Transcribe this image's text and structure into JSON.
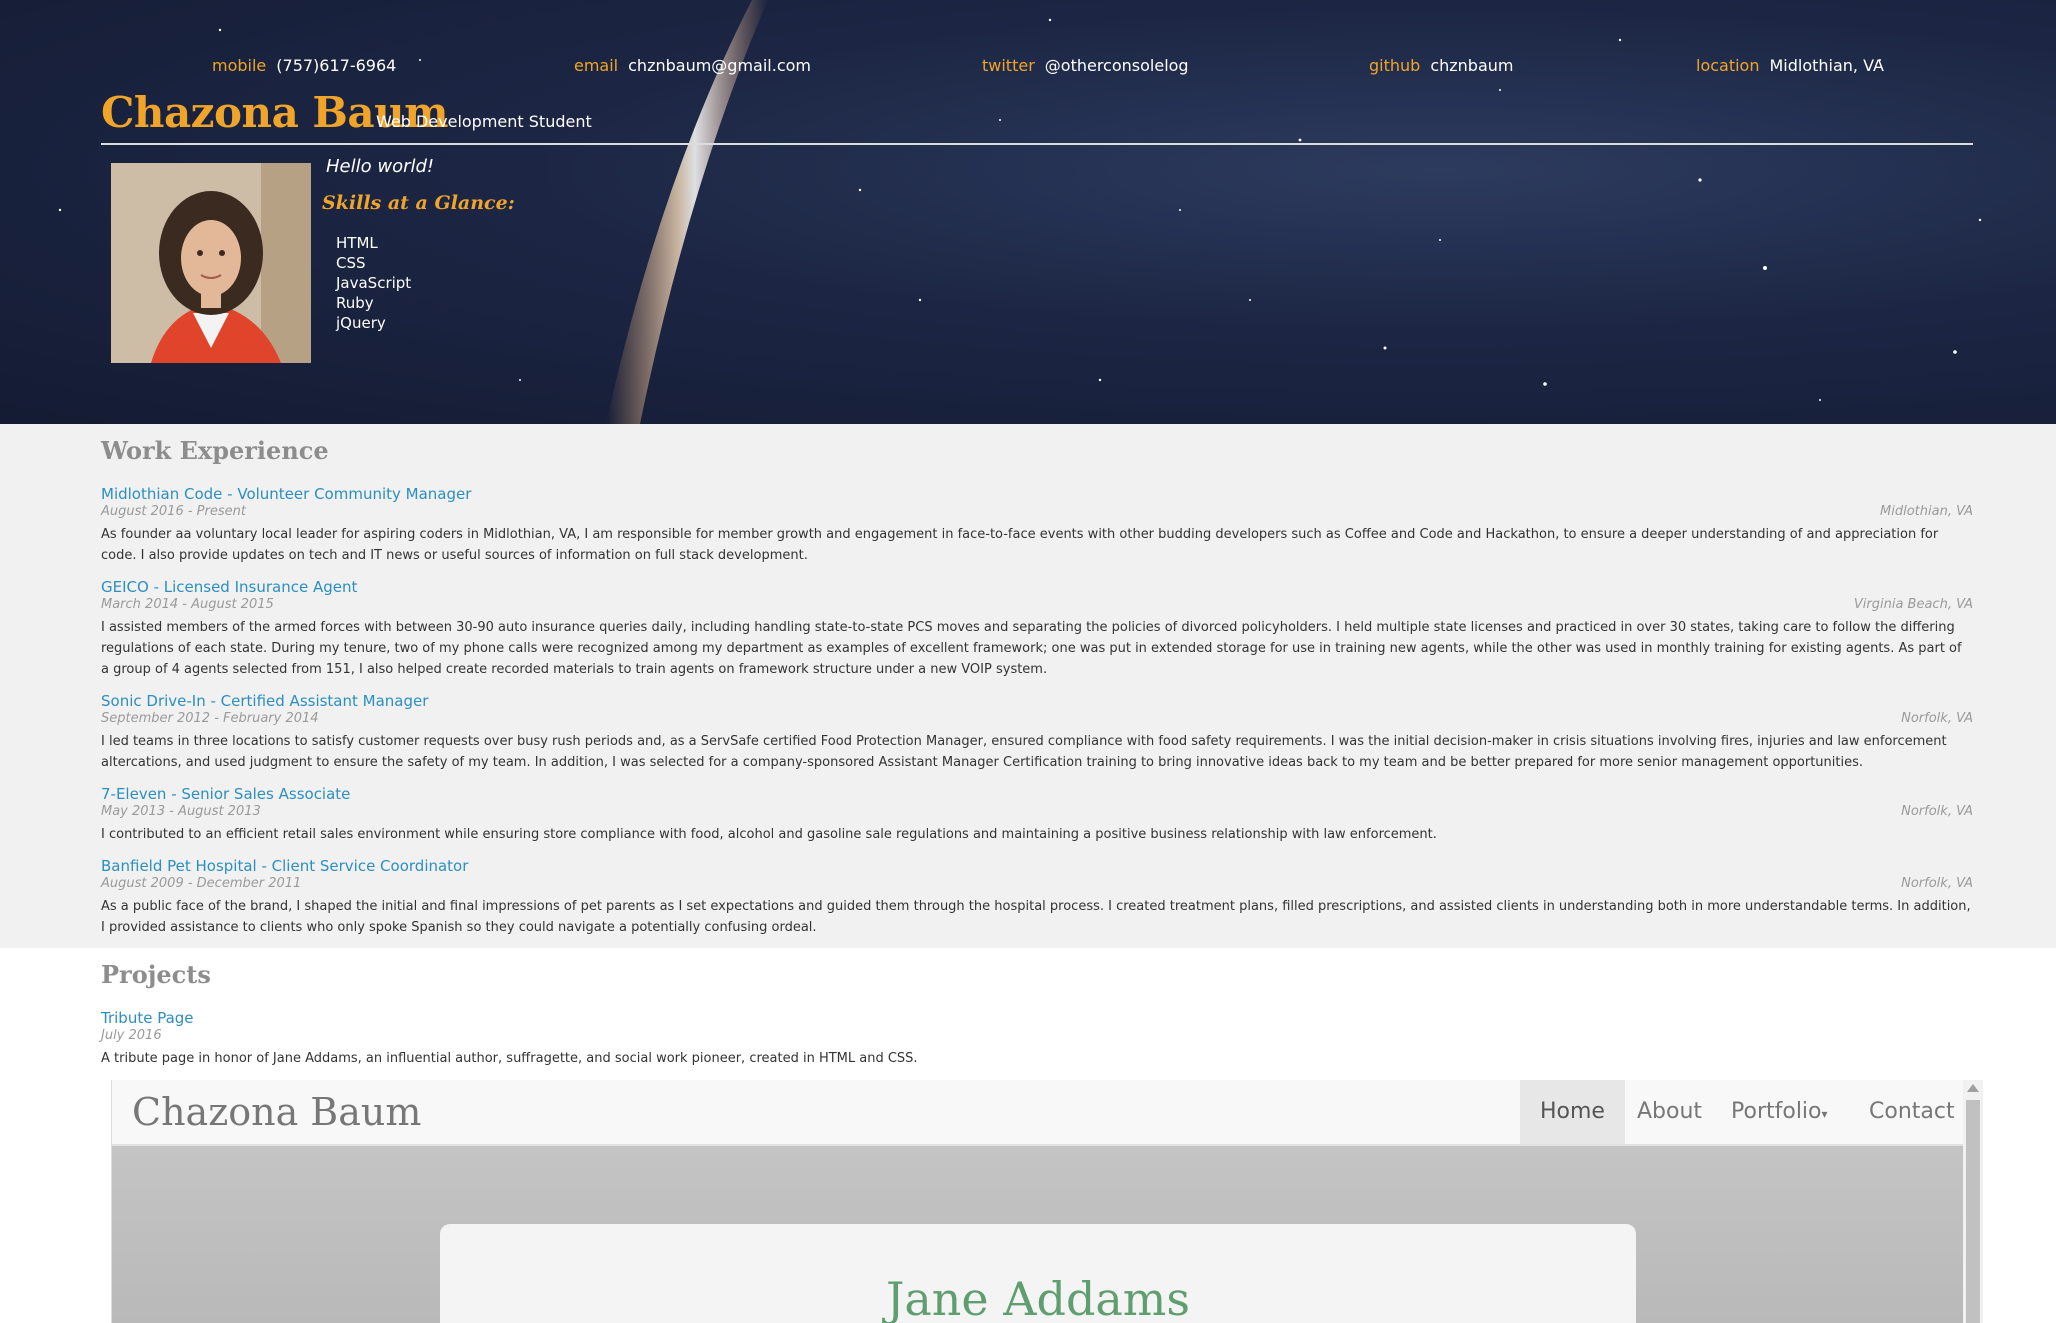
{
  "header": {
    "contacts": [
      {
        "key": "mobile",
        "value": "(757)617-6964"
      },
      {
        "key": "email",
        "value": "chznbaum@gmail.com"
      },
      {
        "key": "twitter",
        "value": "@otherconsolelog"
      },
      {
        "key": "github",
        "value": "chznbaum"
      },
      {
        "key": "location",
        "value": "Midlothian, VA"
      }
    ],
    "name": "Chazona Baum",
    "role": "Web Development Student",
    "greeting": "Hello world!",
    "skills_title": "Skills at a Glance:",
    "skills": [
      "HTML",
      "CSS",
      "JavaScript",
      "Ruby",
      "jQuery"
    ]
  },
  "work": {
    "title": "Work Experience",
    "jobs": [
      {
        "title": "Midlothian Code - Volunteer Community Manager",
        "dates": "August 2016 - Present",
        "location": "Midlothian, VA",
        "description": "As founder aa voluntary local leader for aspiring coders in Midlothian, VA, I am responsible for member growth and engagement in face-to-face events with other budding developers such as Coffee and Code and Hackathon, to ensure a deeper understanding of and appreciation for code. I also provide updates on tech and IT news or useful sources of information on full stack development."
      },
      {
        "title": "GEICO - Licensed Insurance Agent",
        "dates": "March 2014 - August 2015",
        "location": "Virginia Beach, VA",
        "description": "I assisted members of the armed forces with between 30-90 auto insurance queries daily, including handling state-to-state PCS moves and separating the policies of divorced policyholders. I held multiple state licenses and practiced in over 30 states, taking care to follow the differing regulations of each state. During my tenure, two of my phone calls were recognized among my department as examples of excellent framework; one was put in extended storage for use in training new agents, while the other was used in monthly training for existing agents. As part of a group of 4 agents selected from 151, I also helped create recorded materials to train agents on framework structure under a new VOIP system."
      },
      {
        "title": "Sonic Drive-In - Certified Assistant Manager",
        "dates": "September 2012 - February 2014",
        "location": "Norfolk, VA",
        "description": "I led teams in three locations to satisfy customer requests over busy rush periods and, as a ServSafe certified Food Protection Manager, ensured compliance with food safety requirements. I was the initial decision-maker in crisis situations involving fires, injuries and law enforcement altercations, and used judgment to ensure the safety of my team. In addition, I was selected for a company-sponsored Assistant Manager Certification training to bring innovative ideas back to my team and be better prepared for more senior management opportunities."
      },
      {
        "title": "7-Eleven - Senior Sales Associate",
        "dates": "May 2013 - August 2013",
        "location": "Norfolk, VA",
        "description": "I contributed to an efficient retail sales environment while ensuring store compliance with food, alcohol and gasoline sale regulations and maintaining a positive business relationship with law enforcement."
      },
      {
        "title": "Banfield Pet Hospital - Client Service Coordinator",
        "dates": "August 2009 - December 2011",
        "location": "Norfolk, VA",
        "description": "As a public face of the brand, I shaped the initial and final impressions of pet parents as I set expectations and guided them through the hospital process. I created treatment plans, filled prescriptions, and assisted clients in understanding both in more understandable terms. In addition, I provided assistance to clients who only spoke Spanish so they could navigate a potentially confusing ordeal."
      }
    ]
  },
  "projects": {
    "title": "Projects",
    "items": [
      {
        "title": "Tribute Page",
        "date": "July 2016",
        "description": "A tribute page in honor of Jane Addams, an influential author, suffragette, and social work pioneer, created in HTML and CSS."
      }
    ]
  },
  "preview": {
    "brand": "Chazona Baum",
    "nav": [
      "Home",
      "About",
      "Portfolio",
      "Contact"
    ],
    "heading": "Jane Addams"
  },
  "colors": {
    "accent": "#f0a52a",
    "link": "#2c8fc0",
    "section_title": "#8d8d8d"
  }
}
